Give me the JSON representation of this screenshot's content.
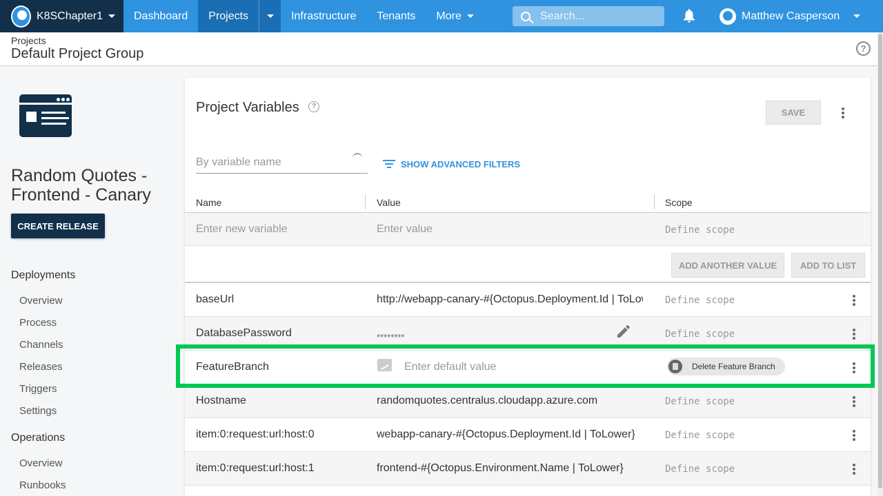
{
  "topnav": {
    "space_name": "K8SChapter1",
    "items": [
      {
        "label": "Dashboard"
      },
      {
        "label": "Projects"
      },
      {
        "label": "Infrastructure"
      },
      {
        "label": "Tenants"
      },
      {
        "label": "More"
      }
    ],
    "search_placeholder": "Search...",
    "user_name": "Matthew Casperson",
    "accent": "#2f93e0",
    "dark": "#12304a"
  },
  "header": {
    "breadcrumb": "Projects",
    "title": "Default Project Group"
  },
  "sidebar": {
    "project_name": "Random Quotes - Frontend - Canary",
    "create_release": "CREATE RELEASE",
    "sections": [
      {
        "title": "Deployments",
        "items": [
          "Overview",
          "Process",
          "Channels",
          "Releases",
          "Triggers",
          "Settings"
        ]
      },
      {
        "title": "Operations",
        "items": [
          "Overview",
          "Runbooks"
        ]
      }
    ]
  },
  "main": {
    "title": "Project Variables",
    "save_label": "SAVE",
    "filter_placeholder": "By variable name",
    "advanced_filters": "SHOW ADVANCED FILTERS",
    "columns": [
      "Name",
      "Value",
      "Scope"
    ],
    "new_row": {
      "name_placeholder": "Enter new variable",
      "value_placeholder": "Enter value",
      "scope_placeholder": "Define scope"
    },
    "add_another_value": "ADD ANOTHER VALUE",
    "add_to_list": "ADD TO LIST",
    "rows": [
      {
        "name": "baseUrl",
        "value": "http://webapp-canary-#{Octopus.Deployment.Id | ToLower}",
        "scope": "Define scope"
      },
      {
        "name": "DatabasePassword",
        "value": "********",
        "scope": "Define scope"
      },
      {
        "name": "FeatureBranch",
        "value": "Enter default value",
        "scope": "Delete Feature Branch"
      },
      {
        "name": "Hostname",
        "value": "randomquotes.centralus.cloudapp.azure.com",
        "scope": "Define scope"
      },
      {
        "name": "item:0:request:url:host:0",
        "value": "webapp-canary-#{Octopus.Deployment.Id | ToLower}",
        "scope": "Define scope"
      },
      {
        "name": "item:0:request:url:host:1",
        "value": "frontend-#{Octopus.Environment.Name | ToLower}",
        "scope": "Define scope"
      }
    ],
    "highlight_color": "#00c853"
  }
}
